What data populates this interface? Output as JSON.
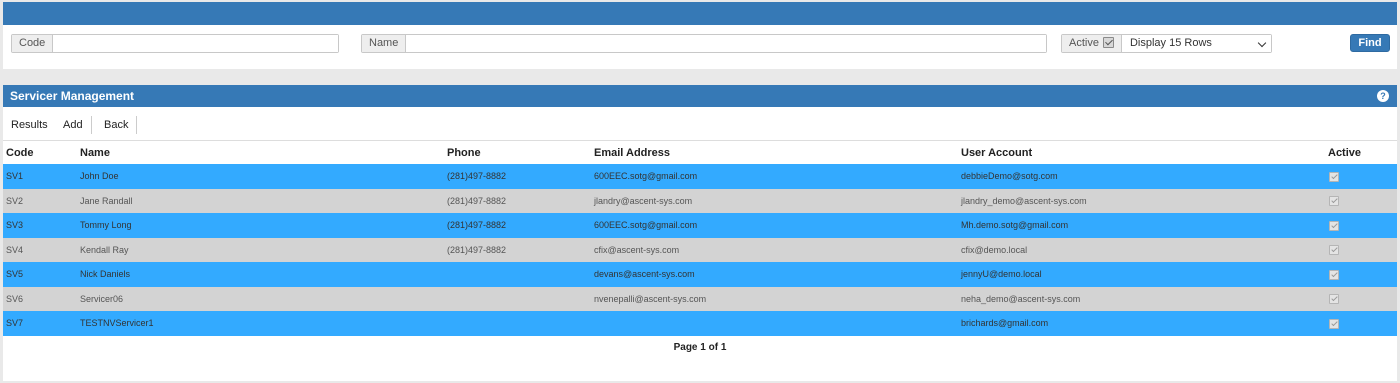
{
  "filters": {
    "code_label": "Code",
    "code_value": "",
    "name_label": "Name",
    "name_value": "",
    "active_label": "Active",
    "display_select": "Display 15 Rows",
    "find_label": "Find"
  },
  "panel": {
    "title": "Servicer Management",
    "help": "?"
  },
  "tabs": [
    "Results",
    "Add",
    "Back"
  ],
  "table": {
    "headers": [
      "Code",
      "Name",
      "Phone",
      "Email Address",
      "User Account",
      "Active"
    ],
    "rows": [
      {
        "code": "SV1",
        "name": "John Doe",
        "phone": "(281)497-8882",
        "email": "600EEC.sotg@gmail.com",
        "user": "debbieDemo@sotg.com",
        "active": true
      },
      {
        "code": "SV2",
        "name": "Jane Randall",
        "phone": "(281)497-8882",
        "email": "jlandry@ascent-sys.com",
        "user": "jlandry_demo@ascent-sys.com",
        "active": true
      },
      {
        "code": "SV3",
        "name": "Tommy Long",
        "phone": "(281)497-8882",
        "email": "600EEC.sotg@gmail.com",
        "user": "Mh.demo.sotg@gmail.com",
        "active": true
      },
      {
        "code": "SV4",
        "name": "Kendall Ray",
        "phone": "(281)497-8882",
        "email": "cfix@ascent-sys.com",
        "user": "cfix@demo.local",
        "active": true
      },
      {
        "code": "SV5",
        "name": "Nick Daniels",
        "phone": "",
        "email": "devans@ascent-sys.com",
        "user": "jennyU@demo.local",
        "active": true
      },
      {
        "code": "SV6",
        "name": "Servicer06",
        "phone": "",
        "email": "nvenepalli@ascent-sys.com",
        "user": "neha_demo@ascent-sys.com",
        "active": true
      },
      {
        "code": "SV7",
        "name": "TESTNVServicer1",
        "phone": "",
        "email": "",
        "user": "brichards@gmail.com",
        "active": true
      }
    ]
  },
  "pager": "Page 1 of 1"
}
